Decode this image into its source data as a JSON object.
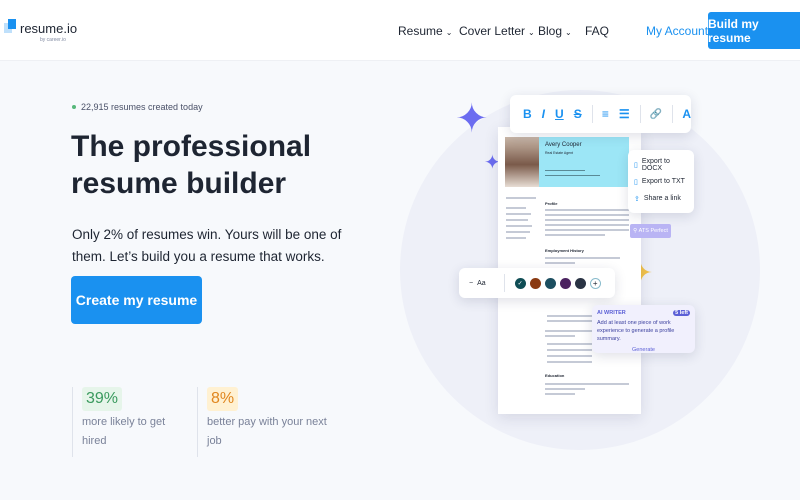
{
  "header": {
    "logo": "resume.io",
    "logo_sub": "by career.io",
    "nav": [
      {
        "label": "Resume",
        "dropdown": true
      },
      {
        "label": "Cover Letter",
        "dropdown": true
      },
      {
        "label": "Blog",
        "dropdown": true
      },
      {
        "label": "FAQ",
        "dropdown": false
      }
    ],
    "account": "My Account",
    "build": "Build my resume"
  },
  "hero": {
    "count": "22,915 resumes created today",
    "title": "The professional resume builder",
    "subtitle": "Only 2% of resumes win. Yours will be one of them. Let’s build you a resume that works.",
    "cta": "Create my resume"
  },
  "stats": [
    {
      "value": "39%",
      "label": "more likely to get hired",
      "color": "#3a9a5e",
      "bg": "#e6f5ea"
    },
    {
      "value": "8%",
      "label": "better pay with your next job",
      "color": "#e0861e",
      "bg": "#fff1d2"
    }
  ],
  "preview": {
    "name": "Avery Cooper",
    "role": "Real Estate Agent",
    "sections": {
      "profile": "Profile",
      "employment": "Employment History",
      "education": "Education"
    },
    "toolbar": [
      "B",
      "I",
      "U",
      "S",
      "≡",
      "☰",
      "🔗",
      "A"
    ],
    "export": [
      "Export to DOCX",
      "Export to TXT",
      "Share a link"
    ],
    "ats": "ATS Perfect",
    "font": "Aa",
    "colors": [
      "#0f4d55",
      "#8a3a12",
      "#1c4e60",
      "#4b2260",
      "#2a3344"
    ],
    "ai": {
      "label": "AI WRITER",
      "badge": "5 left",
      "text": "Add at least one piece of work experience to generate a profile summary.",
      "button": "Generate"
    }
  }
}
